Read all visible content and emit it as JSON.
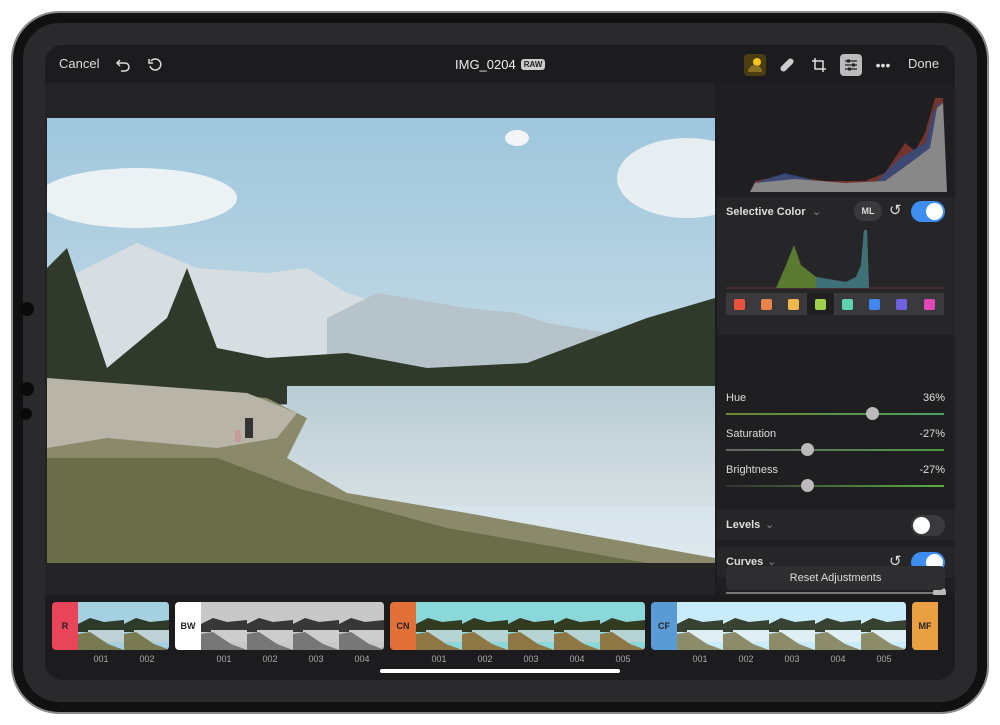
{
  "toolbar": {
    "cancel": "Cancel",
    "title": "IMG_0204",
    "badge": "RAW",
    "done": "Done",
    "icons": [
      "undo-icon",
      "revert-icon",
      "ml-auto-icon",
      "heal-icon",
      "crop-icon",
      "adjustments-icon",
      "more-icon"
    ]
  },
  "panel": {
    "selective_color": {
      "title": "Selective Color",
      "ml": "ML",
      "enabled": true,
      "swatches": [
        "#e8523f",
        "#e8834a",
        "#f0b84a",
        "#9fd14f",
        "#5fd3b0",
        "#3f86f0",
        "#6f62e0",
        "#e048b8"
      ],
      "selected": 3
    },
    "sliders": [
      {
        "label": "Hue",
        "value": "36%",
        "pos": 0.67
      },
      {
        "label": "Saturation",
        "value": "-27%",
        "pos": 0.37
      },
      {
        "label": "Brightness",
        "value": "-27%",
        "pos": 0.37
      }
    ],
    "levels": {
      "title": "Levels",
      "enabled": false
    },
    "curves": {
      "title": "Curves",
      "enabled": true,
      "pos": 1.0
    },
    "reset": "Reset Adjustments"
  },
  "filmstrip": [
    {
      "tag": "R",
      "color": "#e8445a",
      "text": "#222",
      "items": [
        "001",
        "002"
      ]
    },
    {
      "tag": "BW",
      "color": "#ffffff",
      "text": "#222",
      "items": [
        "001",
        "002",
        "003",
        "004"
      ]
    },
    {
      "tag": "CN",
      "color": "#e07038",
      "text": "#222",
      "items": [
        "001",
        "002",
        "003",
        "004",
        "005"
      ]
    },
    {
      "tag": "CF",
      "color": "#5b9bd5",
      "text": "#222",
      "items": [
        "001",
        "002",
        "003",
        "004",
        "005"
      ]
    },
    {
      "tag": "MF",
      "color": "#e8a040",
      "text": "#222",
      "items": []
    }
  ]
}
